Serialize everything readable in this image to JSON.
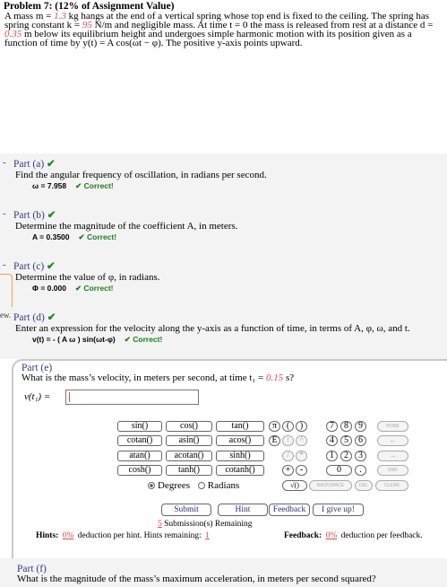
{
  "problem": {
    "title": "Problem 7: (12% of Assignment Value)",
    "line1_a": "A mass m = ",
    "mass": "1.3",
    "line1_b": " kg hangs at the end of a vertical spring whose top end is fixed to the ceiling. The spring has",
    "line2_a": "spring constant k = ",
    "spring_k": "95",
    "line2_b": " N/m and negligible mass. At time t = 0 the mass is released from rest at a distance d =",
    "distance": "0.35",
    "line3_b": " m below its equilibrium height and undergoes simple harmonic motion with its position given as a",
    "line4": "function of time by y(t) = A cos(ωt − φ). The positive y-axis points upward."
  },
  "parts": {
    "a": {
      "dash": "-",
      "title": "Part (a)",
      "check": "✔",
      "question": "Find the angular frequency of oscillation, in radians per second.",
      "answer": "ω = 7.958",
      "status": "✔ Correct!"
    },
    "b": {
      "dash": "-",
      "title": "Part (b)",
      "check": "✔",
      "question": "Determine the magnitude of the coefficient A, in meters.",
      "answer": "A = 0.3500",
      "status": "✔ Correct!"
    },
    "c": {
      "dash": "-",
      "title": "Part (c)",
      "check": "✔",
      "question": "Determine the value of φ, in radians.",
      "answer": "Φ = 0.000",
      "status": "✔ Correct!"
    },
    "d": {
      "prefix": "ew.",
      "title": "Part (d)",
      "check": "✔",
      "question": "Enter an expression for the velocity along the y-axis as a function of time, in terms of A, φ, ω, and t.",
      "answer": "v(t) = - ( A ω ) sin(ωt-φ)",
      "status": "✔ Correct!"
    }
  },
  "part_e": {
    "title": "Part (e)",
    "question_a": "What is the mass’s velocity, in meters per second, at time t₁ = ",
    "time": "0.15",
    "question_b": " s?",
    "answer_label": "v(t₁) = "
  },
  "keypad": {
    "functions": [
      "sin()",
      "cos()",
      "tan()",
      "cotan()",
      "asin()",
      "acos()",
      "atan()",
      "acotan()",
      "sinh()",
      "cosh()",
      "tanh()",
      "cotanh()"
    ],
    "symbols": [
      "π",
      "(",
      ")",
      "E",
      "↑",
      "^",
      "/",
      "*",
      "+",
      "-",
      "√()",
      "BACKSPACE",
      "DEL"
    ],
    "digits": [
      "7",
      "8",
      "9",
      "4",
      "5",
      "6",
      "1",
      "2",
      "3",
      "0",
      "."
    ],
    "nav": [
      "HOME",
      "←",
      "→",
      "END",
      "CLEAR"
    ],
    "degrees": "Degrees",
    "radians": "Radians"
  },
  "actions": {
    "submit": "Submit",
    "hint": "Hint",
    "feedback": "Feedback",
    "give_up": "I give up!",
    "submissions_count": "5",
    "submissions_text": " Submission(s) Remaining",
    "hints_label": "Hints:",
    "hints_pct": "0%",
    "hints_text": "deduction per hint. Hints remaining:",
    "hints_remaining": "1",
    "feedback_label": "Feedback:",
    "feedback_pct": "0%",
    "feedback_text": "deduction per feedback."
  },
  "part_f": {
    "title": "Part (f)",
    "question": "What is the magnitude of the mass’s maximum acceleration, in meters per second squared?"
  },
  "colors": {
    "accent_text": "#333a8a",
    "correct_green": "#1b7d1b",
    "value_red": "#e8474e"
  }
}
